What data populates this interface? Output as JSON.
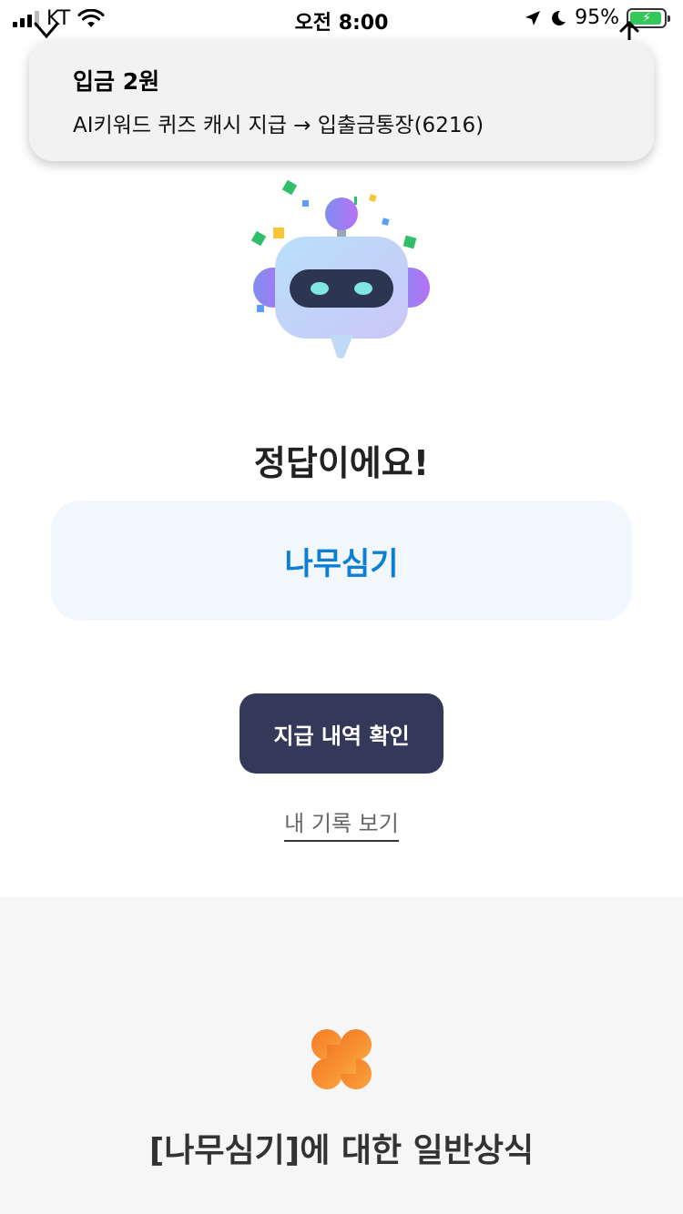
{
  "status_bar": {
    "carrier": "KT",
    "time": "오전 8:00",
    "battery": "95%",
    "battery_level": 0.95
  },
  "notification": {
    "title": "입금 2원",
    "body": "AI키워드 퀴즈 캐시 지급 → 입출금통장(6216)"
  },
  "result": {
    "title": "정답이에요!",
    "answer": "나무심기",
    "answer_color": "#0a7fd3"
  },
  "actions": {
    "primary_label": "지급 내역 확인",
    "secondary_label": "내 기록 보기",
    "primary_color": "#34395a"
  },
  "info": {
    "title": "[나무심기]에 대한 일반상식",
    "icon": "clover-icon",
    "icon_color": "#f5892f"
  },
  "icons": {
    "signal": "signal-icon",
    "wifi": "wifi-icon",
    "location": "location-arrow-icon",
    "moon": "moon-icon",
    "battery": "battery-charging-icon",
    "robot": "robot-mascot-icon"
  }
}
